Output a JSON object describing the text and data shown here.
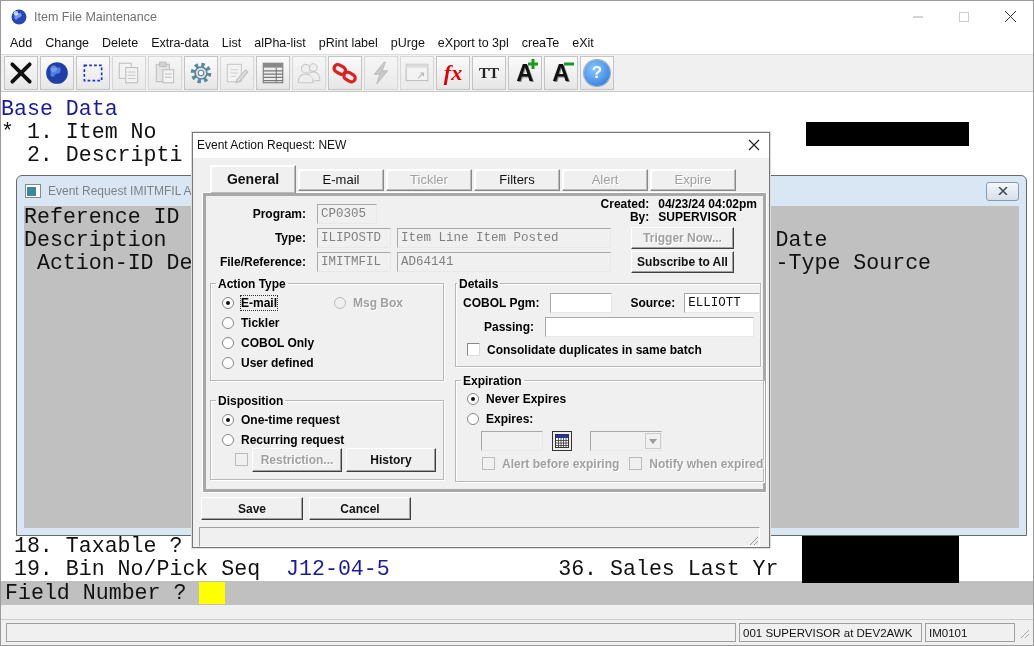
{
  "window": {
    "title": "Item File Maintenance"
  },
  "menu": [
    "Add",
    "Change",
    "Delete",
    "Extra-data",
    "List",
    "alPha-list",
    "pRint label",
    "pUrge",
    "eXport to 3pl",
    "creaTe",
    "eXit"
  ],
  "toolbar": [
    {
      "kind": "close",
      "disabled": false
    },
    {
      "kind": "globe",
      "disabled": false
    },
    {
      "kind": "select",
      "disabled": false
    },
    {
      "kind": "copy",
      "disabled": true
    },
    {
      "kind": "paste",
      "disabled": true
    },
    {
      "kind": "settings",
      "disabled": false
    },
    {
      "kind": "edit",
      "disabled": true
    },
    {
      "kind": "table",
      "disabled": false
    },
    {
      "kind": "people",
      "disabled": true
    },
    {
      "kind": "link",
      "disabled": false
    },
    {
      "kind": "lightning",
      "disabled": true
    },
    {
      "kind": "window",
      "disabled": true
    },
    {
      "kind": "function",
      "label": "fx",
      "disabled": false
    },
    {
      "kind": "font",
      "label": "TT",
      "disabled": false
    },
    {
      "kind": "font-larger",
      "label": "A",
      "disabled": false
    },
    {
      "kind": "font-smaller",
      "label": "A",
      "disabled": false
    },
    {
      "kind": "help",
      "label": "?",
      "disabled": false
    }
  ],
  "screen": {
    "top_lines": [
      [
        {
          "text": "Base Data",
          "kind": "heading"
        }
      ],
      [
        {
          "text": "* 1. Item No",
          "kind": "label"
        }
      ],
      [
        {
          "text": "2. Descripti",
          "kind": "label"
        }
      ]
    ],
    "bottom_lines": [
      [
        {
          "text": "18. Taxable ?",
          "kind": "label"
        }
      ],
      [
        {
          "text": "19. Bin No/Pick Seq",
          "kind": "label"
        },
        {
          "text": "J12-04-5",
          "kind": "value"
        },
        {
          "text": "36. Sales Last Yr",
          "kind": "label"
        }
      ]
    ],
    "prompt": "Field Number ?"
  },
  "event_window": {
    "title": "Event Request IMITMFIL A",
    "lines": [
      [
        {
          "text": "Reference ID"
        }
      ],
      [
        {
          "text": "Description"
        },
        {
          "text": "Date"
        }
      ],
      [
        {
          "text": "Action-ID De"
        },
        {
          "text": "-Type Source"
        }
      ]
    ]
  },
  "dialog": {
    "title": "Event Action Request: NEW",
    "tabs": [
      {
        "label": "General",
        "selected": true,
        "disabled": false
      },
      {
        "label": "E-mail",
        "selected": false,
        "disabled": false
      },
      {
        "label": "Tickler",
        "selected": false,
        "disabled": true
      },
      {
        "label": "Filters",
        "selected": false,
        "disabled": false
      },
      {
        "label": "Alert",
        "selected": false,
        "disabled": true
      },
      {
        "label": "Expire",
        "selected": false,
        "disabled": true
      }
    ],
    "fields": [
      {
        "label": "Program:",
        "values": [
          "CP0305"
        ]
      },
      {
        "label": "Type:",
        "values": [
          "ILIPOSTD",
          "Item Line Item Posted"
        ]
      },
      {
        "label": "File/Reference:",
        "values": [
          "IMITMFIL",
          "AD64141"
        ]
      }
    ],
    "created": {
      "label": "Created:",
      "value": "04/23/24 04:02pm"
    },
    "by": {
      "label": "By:",
      "value": "SUPERVISOR"
    },
    "side_buttons": [
      {
        "label": "Trigger Now...",
        "disabled": true
      },
      {
        "label": "Subscribe to All",
        "disabled": false
      }
    ],
    "action_type": {
      "title": "Action Type",
      "options": [
        {
          "label": "E-mail",
          "selected": true,
          "disabled": false
        },
        {
          "label": "Msg Box",
          "selected": false,
          "disabled": true
        },
        {
          "label": "Tickler",
          "selected": false,
          "disabled": false
        },
        {
          "label": "COBOL Only",
          "selected": false,
          "disabled": false
        },
        {
          "label": "User defined",
          "selected": false,
          "disabled": false
        }
      ]
    },
    "disposition": {
      "title": "Disposition",
      "options": [
        {
          "label": "One-time request",
          "selected": true
        },
        {
          "label": "Recurring request",
          "selected": false
        }
      ],
      "restriction_check": {
        "checked": false,
        "disabled": true
      },
      "buttons": [
        {
          "label": "Restriction...",
          "disabled": true
        },
        {
          "label": "History",
          "disabled": false
        }
      ]
    },
    "details": {
      "title": "Details",
      "cobol_pgm": {
        "label": "COBOL Pgm:"
      },
      "source": {
        "label": "Source:",
        "value": "ELLIOTT"
      },
      "passing": {
        "label": "Passing:"
      },
      "consolidate": {
        "label": "Consolidate duplicates in same batch",
        "checked": false
      }
    },
    "expiration": {
      "title": "Expiration",
      "options": [
        {
          "label": "Never Expires",
          "selected": true
        },
        {
          "label": "Expires:",
          "selected": false
        }
      ],
      "checks": [
        {
          "label": "Alert before expiring",
          "checked": false,
          "disabled": true
        },
        {
          "label": "Notify when expired",
          "checked": false,
          "disabled": true
        }
      ]
    },
    "buttons": [
      "Save",
      "Cancel"
    ]
  },
  "status_bar": [
    "001 SUPERVISOR at DEV2AWK",
    "IM0101"
  ]
}
